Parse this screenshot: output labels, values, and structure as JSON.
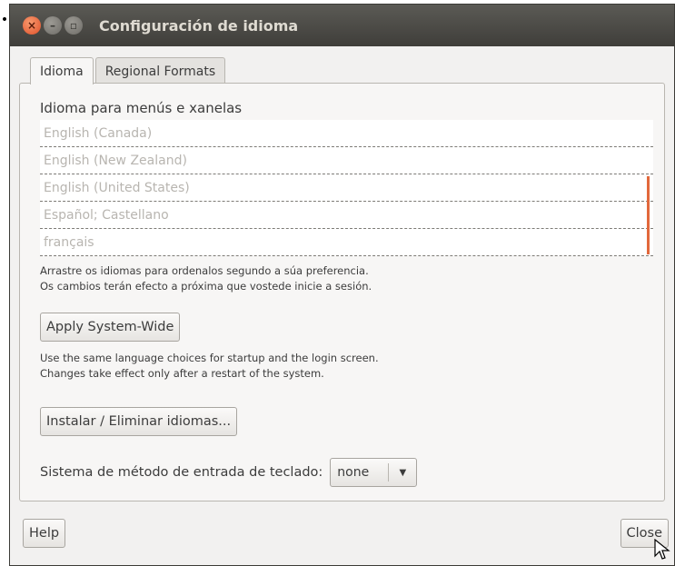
{
  "window": {
    "title": "Configuración de idioma",
    "buttons": [
      "close",
      "minimize",
      "maximize"
    ]
  },
  "tabs": [
    {
      "label": "Idioma",
      "active": true
    },
    {
      "label": "Regional Formats",
      "active": false
    }
  ],
  "language_section": {
    "label": "Idioma para menús e xanelas",
    "languages": [
      "English (Canada)",
      "English (New Zealand)",
      "English (United States)",
      "Español; Castellano",
      "français"
    ],
    "hint_line1": "Arrastre os idiomas para ordenalos segundo a  súa preferencia.",
    "hint_line2": "Os cambios terán efecto a próxima que vostede inicie a sesión."
  },
  "apply_system_wide": {
    "label": "Apply System-Wide",
    "note_line1": "Use the same language choices for startup and the login screen.",
    "note_line2": "Changes take effect only after a restart of the system."
  },
  "install_remove": {
    "label": "Instalar / Eliminar idiomas..."
  },
  "keyboard_input": {
    "label": "Sistema de método de entrada de teclado:",
    "selected": "none"
  },
  "footer": {
    "help_label": "Help",
    "close_label": "Close"
  },
  "colors": {
    "titlebar": "#3f3e3a",
    "close_button": "#e0502a",
    "accent_scrollbar": "#e2683c",
    "window_bg": "#f2f1f0"
  }
}
